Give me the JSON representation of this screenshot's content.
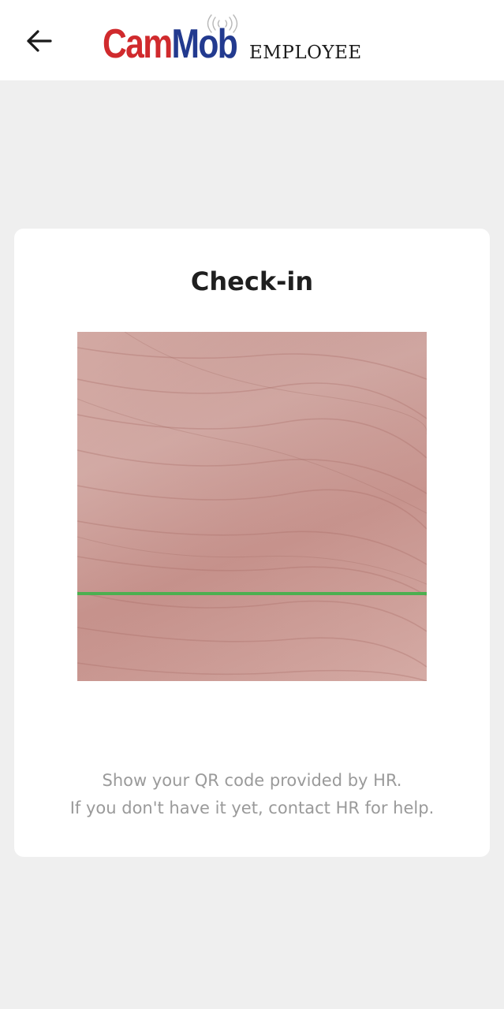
{
  "header": {
    "back_icon": "arrow-left-icon",
    "logo": {
      "cam": "Cam",
      "mob": "Mob",
      "subtitle": "EMPLOYEE",
      "cam_color": "#d02a2d",
      "mob_color": "#223a8f"
    }
  },
  "checkin": {
    "title": "Check-in",
    "scan_line_color": "#4caf50",
    "hint_line_1": "Show your QR code provided by HR.",
    "hint_line_2": "If you don't have it yet, contact HR for help."
  }
}
